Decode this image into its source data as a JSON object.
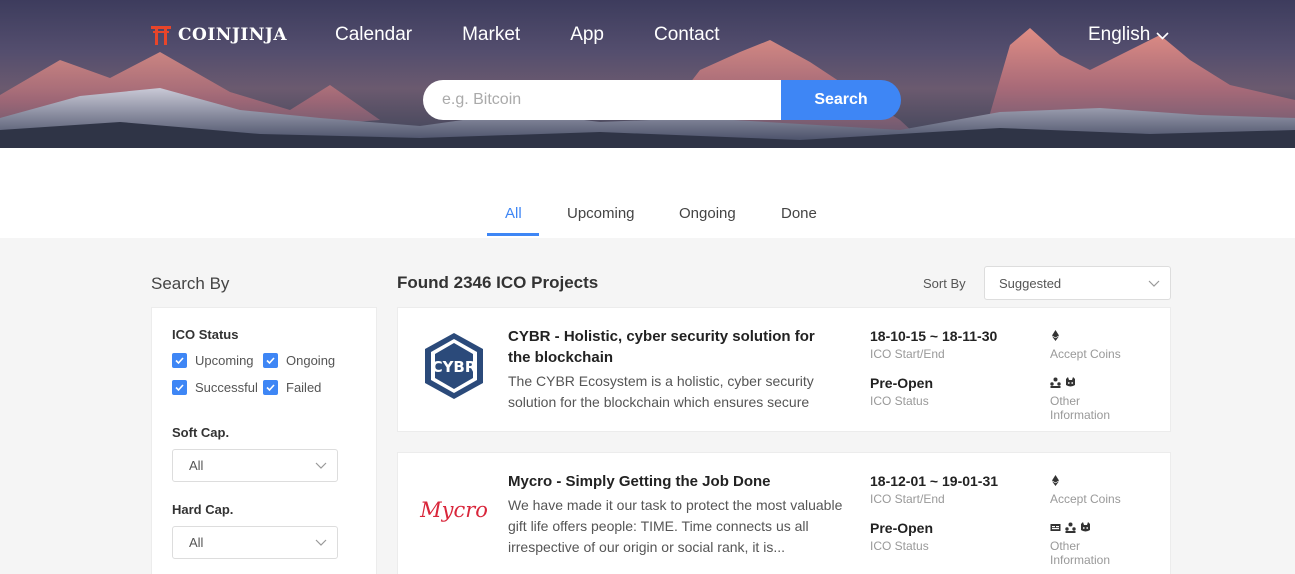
{
  "header": {
    "logo_text": "COINJINJA",
    "nav": [
      "Calendar",
      "Market",
      "App",
      "Contact"
    ],
    "language": "English",
    "search_placeholder": "e.g. Bitcoin",
    "search_button": "Search"
  },
  "tabs": [
    "All",
    "Upcoming",
    "Ongoing",
    "Done"
  ],
  "active_tab": "All",
  "sidebar": {
    "title": "Search By",
    "ico_status_label": "ICO Status",
    "statuses": [
      {
        "label": "Upcoming",
        "checked": true
      },
      {
        "label": "Ongoing",
        "checked": true
      },
      {
        "label": "Successful",
        "checked": true
      },
      {
        "label": "Failed",
        "checked": true
      }
    ],
    "soft_cap_label": "Soft Cap.",
    "soft_cap_value": "All",
    "hard_cap_label": "Hard Cap.",
    "hard_cap_value": "All"
  },
  "main": {
    "found_text": "Found 2346 ICO Projects",
    "sort_label": "Sort By",
    "sort_value": "Suggested",
    "projects": [
      {
        "title": "CYBR - Holistic, cyber security solution for the blockchain",
        "description": "The CYBR Ecosystem is a holistic, cyber security solution for the blockchain which ensures secure",
        "dates": "18-10-15 ~ 18-11-30",
        "dates_caption": "ICO Start/End",
        "status": "Pre-Open",
        "status_caption": "ICO Status",
        "accept_caption": "Accept Coins",
        "other_caption_1": "Other",
        "other_caption_2": "Information"
      },
      {
        "title": "Mycro - Simply Getting the Job Done",
        "description": "We have made it our task to protect the most valuable gift life offers people: TIME. Time connects us all irrespective of our origin or social rank, it is...",
        "dates": "18-12-01 ~ 19-01-31",
        "dates_caption": "ICO Start/End",
        "status": "Pre-Open",
        "status_caption": "ICO Status",
        "accept_caption": "Accept Coins",
        "other_caption_1": "Other",
        "other_caption_2": "Information"
      }
    ]
  },
  "colors": {
    "accent": "#3e86f5",
    "logo_red": "#e8452a",
    "mycro_red": "#d9263b",
    "cybr_blue": "#2b4a7a"
  },
  "icons": [
    "torii-icon",
    "chevron-down-icon",
    "checkmark-icon",
    "ethereum-icon",
    "team-icon",
    "github-icon",
    "whitepaper-icon"
  ]
}
